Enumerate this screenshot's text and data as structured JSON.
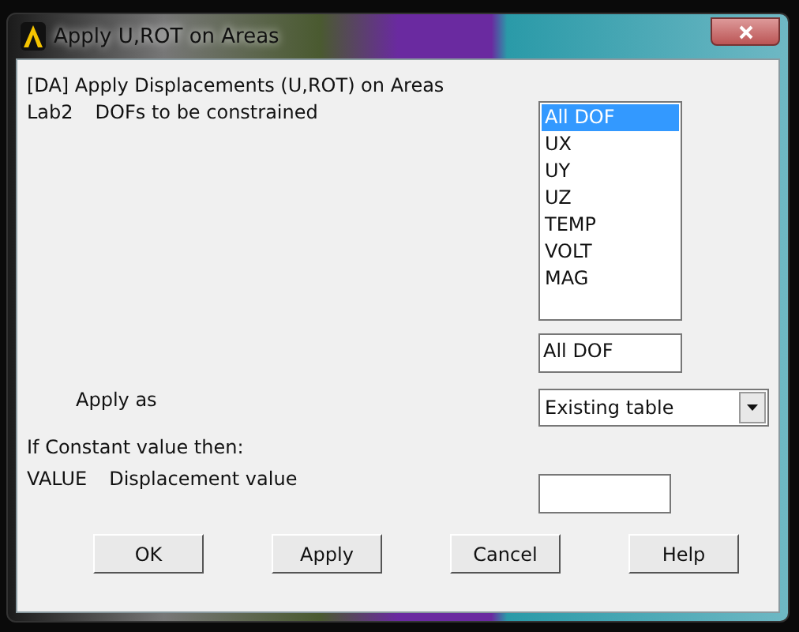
{
  "window": {
    "title": "Apply U,ROT on Areas"
  },
  "heading": "[DA]  Apply Displacements (U,ROT) on Areas",
  "dof_row": {
    "code": "Lab2",
    "label": "DOFs to be constrained"
  },
  "dof_list": [
    {
      "label": "All DOF",
      "selected": true
    },
    {
      "label": "UX",
      "selected": false
    },
    {
      "label": "UY",
      "selected": false
    },
    {
      "label": "UZ",
      "selected": false
    },
    {
      "label": "TEMP",
      "selected": false
    },
    {
      "label": "VOLT",
      "selected": false
    },
    {
      "label": "MAG",
      "selected": false
    }
  ],
  "dof_value": "All DOF",
  "apply_as": {
    "label": "Apply as",
    "value": "Existing table"
  },
  "constant_note": "If Constant value then:",
  "value_row": {
    "code": "VALUE",
    "label": "Displacement value"
  },
  "buttons": [
    "OK",
    "Apply",
    "Cancel",
    "Help"
  ]
}
